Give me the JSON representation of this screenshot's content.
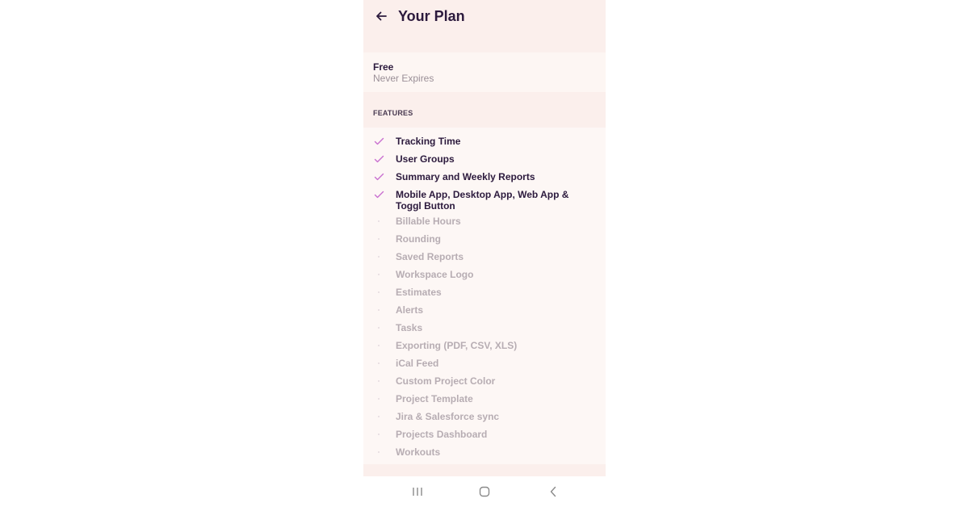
{
  "header": {
    "back_icon": "arrow-left-icon",
    "title": "Your Plan"
  },
  "plan": {
    "name": "Free",
    "expiry": "Never Expires"
  },
  "features": {
    "section_label": "FEATURES",
    "included_icon": "check-icon",
    "excluded_icon": "dot-icon",
    "accent_color": "#c96fd0",
    "items": [
      {
        "label": "Tracking Time",
        "included": true
      },
      {
        "label": "User Groups",
        "included": true
      },
      {
        "label": "Summary and Weekly Reports",
        "included": true
      },
      {
        "label": "Mobile App, Desktop App, Web App & Toggl Button",
        "included": true
      },
      {
        "label": "Billable Hours",
        "included": false
      },
      {
        "label": "Rounding",
        "included": false
      },
      {
        "label": "Saved Reports",
        "included": false
      },
      {
        "label": "Workspace Logo",
        "included": false
      },
      {
        "label": "Estimates",
        "included": false
      },
      {
        "label": "Alerts",
        "included": false
      },
      {
        "label": "Tasks",
        "included": false
      },
      {
        "label": "Exporting (PDF, CSV, XLS)",
        "included": false
      },
      {
        "label": "iCal Feed",
        "included": false
      },
      {
        "label": "Custom Project Color",
        "included": false
      },
      {
        "label": "Project Template",
        "included": false
      },
      {
        "label": "Jira & Salesforce sync",
        "included": false
      },
      {
        "label": "Projects Dashboard",
        "included": false
      },
      {
        "label": "Workouts",
        "included": false
      }
    ]
  },
  "system_nav": {
    "recents_icon": "recent-apps-icon",
    "home_icon": "home-icon",
    "back_icon": "back-chevron-icon"
  }
}
